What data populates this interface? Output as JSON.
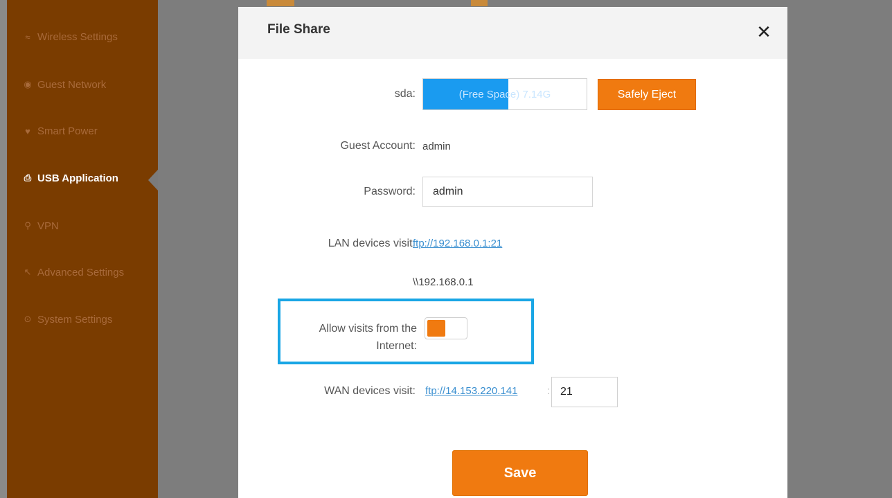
{
  "sidebar": {
    "items": [
      {
        "label": "Wireless Settings",
        "icon": "wifi-icon",
        "glyph": "≈",
        "active": false
      },
      {
        "label": "Guest Network",
        "icon": "guest-icon",
        "glyph": "◉",
        "active": false
      },
      {
        "label": "Smart Power",
        "icon": "bulb-icon",
        "glyph": "♥",
        "active": false
      },
      {
        "label": "USB Application",
        "icon": "usb-icon",
        "glyph": "⎙",
        "active": true
      },
      {
        "label": "VPN",
        "icon": "vpn-icon",
        "glyph": "⚲",
        "active": false
      },
      {
        "label": "Advanced Settings",
        "icon": "wrench-icon",
        "glyph": "↖",
        "active": false
      },
      {
        "label": "System Settings",
        "icon": "gear-icon",
        "glyph": "⊙",
        "active": false
      }
    ]
  },
  "modal": {
    "title": "File Share",
    "close_glyph": "✕",
    "storage": {
      "label": "sda:",
      "text": "(Free Space) 7.14G",
      "used_fraction": 0.52,
      "eject_label": "Safely Eject"
    },
    "guest_account": {
      "label": "Guest Account:",
      "value": "admin"
    },
    "password": {
      "label": "Password:",
      "value": "admin"
    },
    "lan": {
      "label": "LAN devices visit:",
      "ftp": "ftp://192.168.0.1:21",
      "smb": "\\\\192.168.0.1"
    },
    "internet": {
      "label": "Allow visits from the Internet:",
      "enabled": true
    },
    "wan": {
      "label": "WAN devices visit:",
      "ftp": "ftp://14.153.220.141",
      "port": "21"
    },
    "save_label": "Save"
  },
  "colors": {
    "accent": "#f07a10",
    "sidebar": "#7a3c00",
    "highlight": "#19a6e5",
    "storage_fill": "#1a9bf0"
  }
}
